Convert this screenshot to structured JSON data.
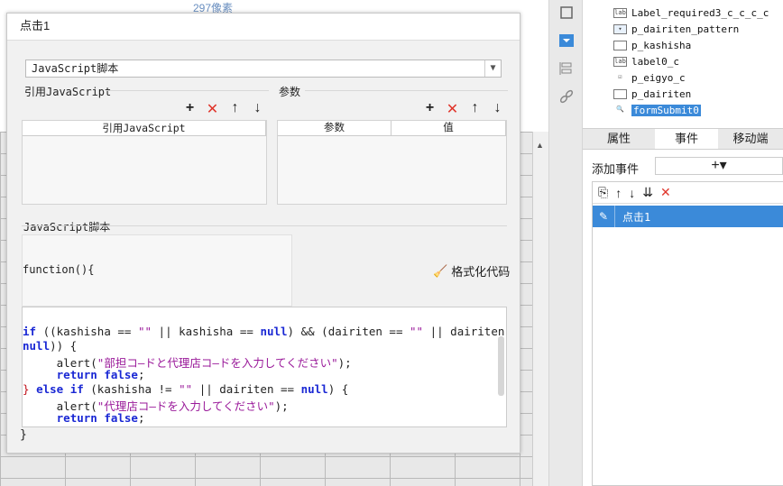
{
  "background": {
    "ruler_text": "297像素"
  },
  "tree": {
    "items": [
      {
        "label": "Label_required3_c_c_c_c",
        "icon": "lab"
      },
      {
        "label": "p_dairiten_pattern",
        "icon": "dropdown"
      },
      {
        "label": "p_kashisha",
        "icon": "textbox"
      },
      {
        "label": "label0_c",
        "icon": "lab"
      },
      {
        "label": "p_eigyo_c",
        "icon": "checkbox"
      },
      {
        "label": "p_dairiten",
        "icon": "textbox"
      },
      {
        "label": "formSubmit0",
        "icon": "form",
        "selected": true
      }
    ]
  },
  "tabs": [
    "属性",
    "事件",
    "移动端"
  ],
  "events": {
    "add_label": "添加事件",
    "add_button": "+▾",
    "rows": [
      {
        "label": "点击1"
      }
    ]
  },
  "dialog": {
    "title": "点击1",
    "script_type": "JavaScript脚本",
    "ref_section_label": "引用JavaScript",
    "param_section_label": "参数",
    "ref_table_header": "引用JavaScript",
    "param_table_headers": [
      "参数",
      "值"
    ],
    "script_section_label": "JavaScript脚本",
    "function_line": "function(){",
    "format_button": "格式化代码",
    "code_lines": {
      "l1a": "if ((kashisha == \"\" || kashisha == null) && (dairiten == \"\" || dairiten ==",
      "l2": "null)) {",
      "l3_fn": "alert(",
      "l3_str": "\"部担コ―ドと代理店コ―ドを入力してください\"",
      "l3_end": ");",
      "l4": "return false;",
      "l5": "} else if (kashisha != \"\" || dairiten == null) {",
      "l6_fn": "alert(",
      "l6_str": "\"代理店コ―ドを入力してください\"",
      "l6_end": ");",
      "l7": "return false;"
    },
    "closing_brace": "}"
  },
  "colors": {
    "accent": "#3b8ad9",
    "delete": "#e0352b"
  }
}
